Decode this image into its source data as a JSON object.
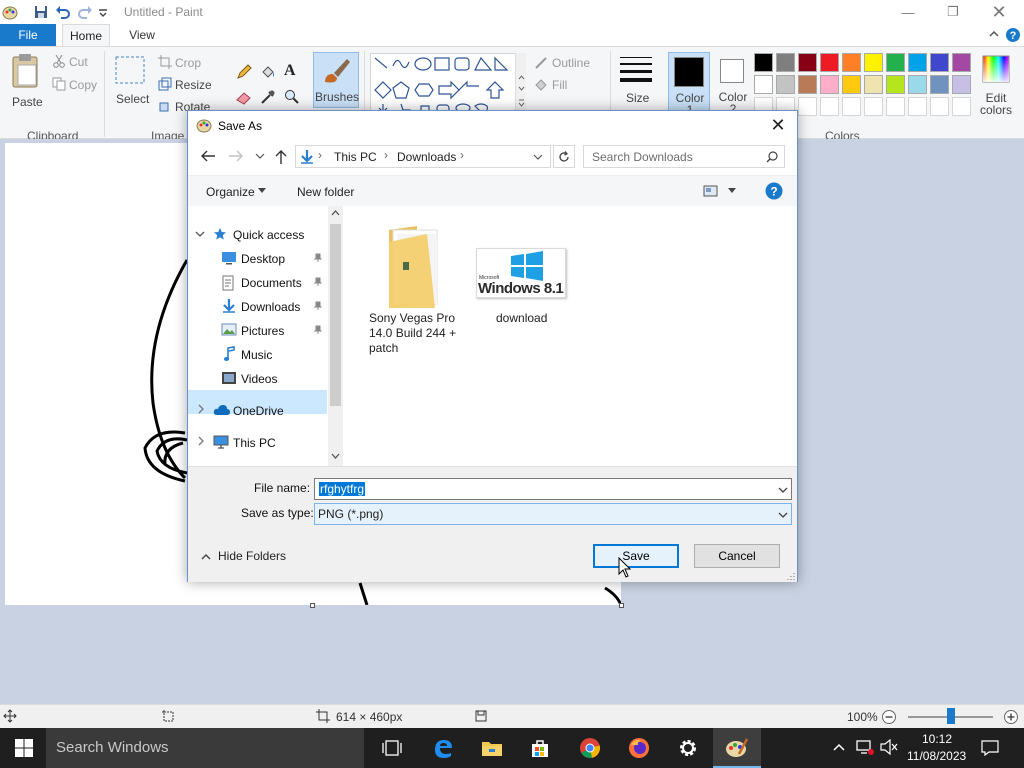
{
  "window": {
    "title": "Untitled - Paint"
  },
  "ribbon": {
    "tabs": [
      "File",
      "Home",
      "View"
    ],
    "clipboard": {
      "paste": "Paste",
      "cut": "Cut",
      "copy": "Copy",
      "group": "Clipboard"
    },
    "image": {
      "select": "Select",
      "crop": "Crop",
      "resize": "Resize",
      "rotate": "Rotate",
      "group": "Image"
    },
    "brushes": "Brushes",
    "shapes": {
      "outline": "Outline",
      "fill": "Fill"
    },
    "size": "Size",
    "color1": "Color 1",
    "color2": "Color 2",
    "colors_group": "Colors",
    "edit_colors": "Edit colors",
    "palette_row1": [
      "#000000",
      "#7f7f7f",
      "#880015",
      "#ed1c24",
      "#ff7f27",
      "#fff200",
      "#22b14c",
      "#00a2e8",
      "#3f48cc",
      "#a349a4"
    ],
    "palette_row2": [
      "#ffffff",
      "#c3c3c3",
      "#b97a57",
      "#ffaec9",
      "#ffc90e",
      "#efe4b0",
      "#b5e61d",
      "#99d9ea",
      "#7092be",
      "#c8bfe7"
    ]
  },
  "status": {
    "dimensions": "614 × 460px",
    "zoom": "100%",
    "zoom_fraction": 0.5
  },
  "taskbar": {
    "search_placeholder": "Search Windows",
    "time": "10:12",
    "date": "11/08/2023"
  },
  "dialog": {
    "title": "Save As",
    "address": [
      "This PC",
      "Downloads"
    ],
    "search_placeholder": "Search Downloads",
    "organize": "Organize",
    "new_folder": "New folder",
    "nav": {
      "quick_access": "Quick access",
      "desktop": "Desktop",
      "documents": "Documents",
      "downloads": "Downloads",
      "pictures": "Pictures",
      "music": "Music",
      "videos": "Videos",
      "onedrive": "OneDrive",
      "this_pc": "This PC"
    },
    "files": [
      {
        "name": "Sony Vegas Pro 14.0 Build 244 + patch",
        "line1": "Sony Vegas Pro",
        "line2": "14.0 Build 244 +",
        "line3": "patch"
      },
      {
        "name": "download",
        "thumb_text": "Windows 8.1",
        "thumb_small": "Microsoft"
      }
    ],
    "file_name_label": "File name:",
    "file_name_value": "rfghytfrg",
    "save_as_type_label": "Save as type:",
    "save_as_type_value": "PNG (*.png)",
    "hide_folders": "Hide Folders",
    "save": "Save",
    "cancel": "Cancel"
  }
}
